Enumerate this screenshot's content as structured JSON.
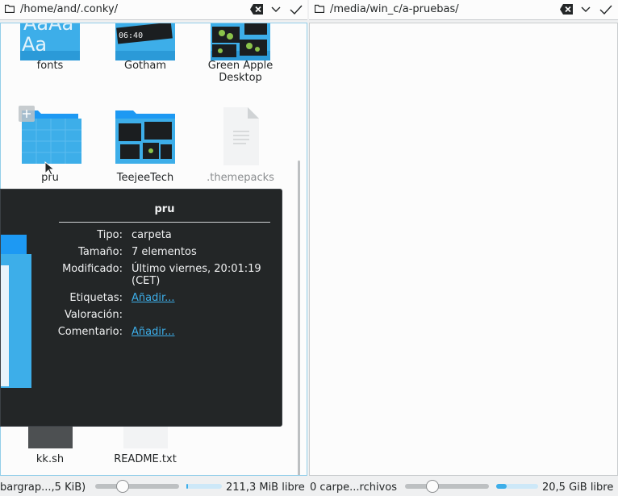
{
  "left": {
    "path": "/home/and/.conky/",
    "items": [
      {
        "label": "fonts"
      },
      {
        "label": "Gotham",
        "clock": "06:40"
      },
      {
        "label": "Green Apple Desktop"
      },
      {
        "label": "pru"
      },
      {
        "label": "TeejeeTech"
      },
      {
        "label": ".themepacks"
      },
      {
        "label": "kk.sh"
      },
      {
        "label": "README.txt"
      }
    ]
  },
  "right": {
    "path": "/media/win_c/a-pruebas/"
  },
  "tooltip": {
    "title": "pru",
    "rows": [
      {
        "key": "Tipo:",
        "value": "carpeta"
      },
      {
        "key": "Tamaño:",
        "value": "7 elementos"
      },
      {
        "key": "Modificado:",
        "value": "Último viernes, 20:01:19",
        "value2": "(CET)"
      },
      {
        "key": "Etiquetas:",
        "value": "Añadir..."
      },
      {
        "key": "Valoración:",
        "value": ""
      },
      {
        "key": "Comentario:",
        "value": "Añadir..."
      }
    ]
  },
  "status": {
    "left_text": "bargrap...,5 KiB)",
    "left_free": "211,3 MiB libre",
    "right_text": "0 carpe...rchivos",
    "right_free": "20,5 GiB libre",
    "left_zoom": 0.3,
    "right_zoom": 0.3,
    "left_usage": 0.05,
    "right_usage": 0.25
  },
  "colors": {
    "folder": "#3daee9",
    "folder_dark": "#1d99f3",
    "accent": "#3daee9",
    "tooltip_bg": "#232627"
  }
}
